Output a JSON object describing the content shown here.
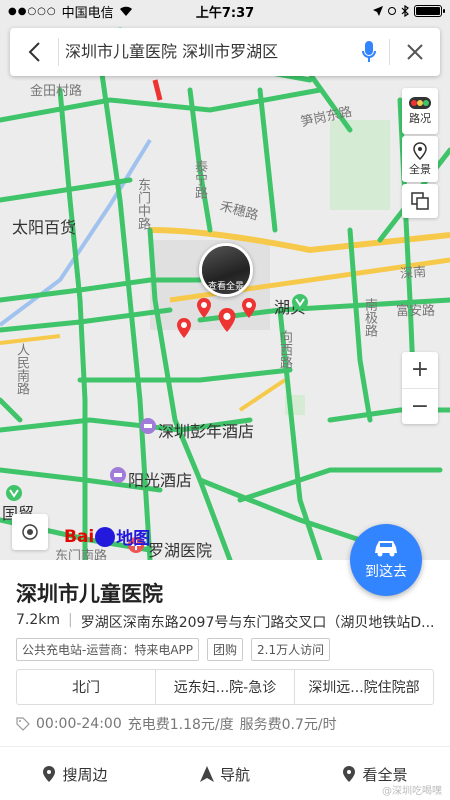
{
  "status_bar": {
    "carrier": "中国电信",
    "time": "上午7:37",
    "signal": "●●○○○"
  },
  "search": {
    "query": "深圳市儿童医院 深圳市罗湖区"
  },
  "map_controls": {
    "traffic_label": "路况",
    "panorama_label": "全景"
  },
  "map_labels": {
    "jintianli": "金田村路",
    "taiyang": "太阳百货",
    "taining": "泰宁路",
    "songyuan": "笋岗东路",
    "hebei": "禾穗路",
    "dongmenzhong": "东门中路",
    "hubei": "湖贝",
    "fuan": "富安路",
    "nanhu": "南极路",
    "xiangxi": "向西路",
    "renminnan": "人民南路",
    "pengnian": "深圳彭年酒店",
    "yangguang": "阳光酒店",
    "shennan": "深南",
    "dongmennan": "东门南路",
    "guomao": "国贸",
    "luohu_hospital": "罗湖医院",
    "photo_caption": "查看全景"
  },
  "go_button": {
    "label": "到这去"
  },
  "place": {
    "name": "深圳市儿童医院",
    "distance": "7.2km",
    "address": "罗湖区深南东路2097号与东门路交叉口（湖贝地铁站D...",
    "tags": [
      "公共充电站-运营商：特来电APP",
      "团购",
      "2.1万人访问"
    ],
    "entrances": [
      "北门",
      "远东妇...院-急诊",
      "深圳远...院住院部"
    ],
    "hours": "00:00-24:00",
    "fee": "充电费1.18元/度",
    "service_fee": "服务费0.7元/时"
  },
  "actions": {
    "nearby": "搜周边",
    "navigate": "导航",
    "panorama": "看全景"
  },
  "baidu": {
    "bai": "Bai",
    "du": "地图"
  },
  "watermark": "@深圳吃喝嘿",
  "colors": {
    "map_bg": "#ececec",
    "road_green": "#3fc46a",
    "road_yellow": "#f6c94a",
    "accent_blue": "#3385ff",
    "pin_red": "#e33"
  }
}
